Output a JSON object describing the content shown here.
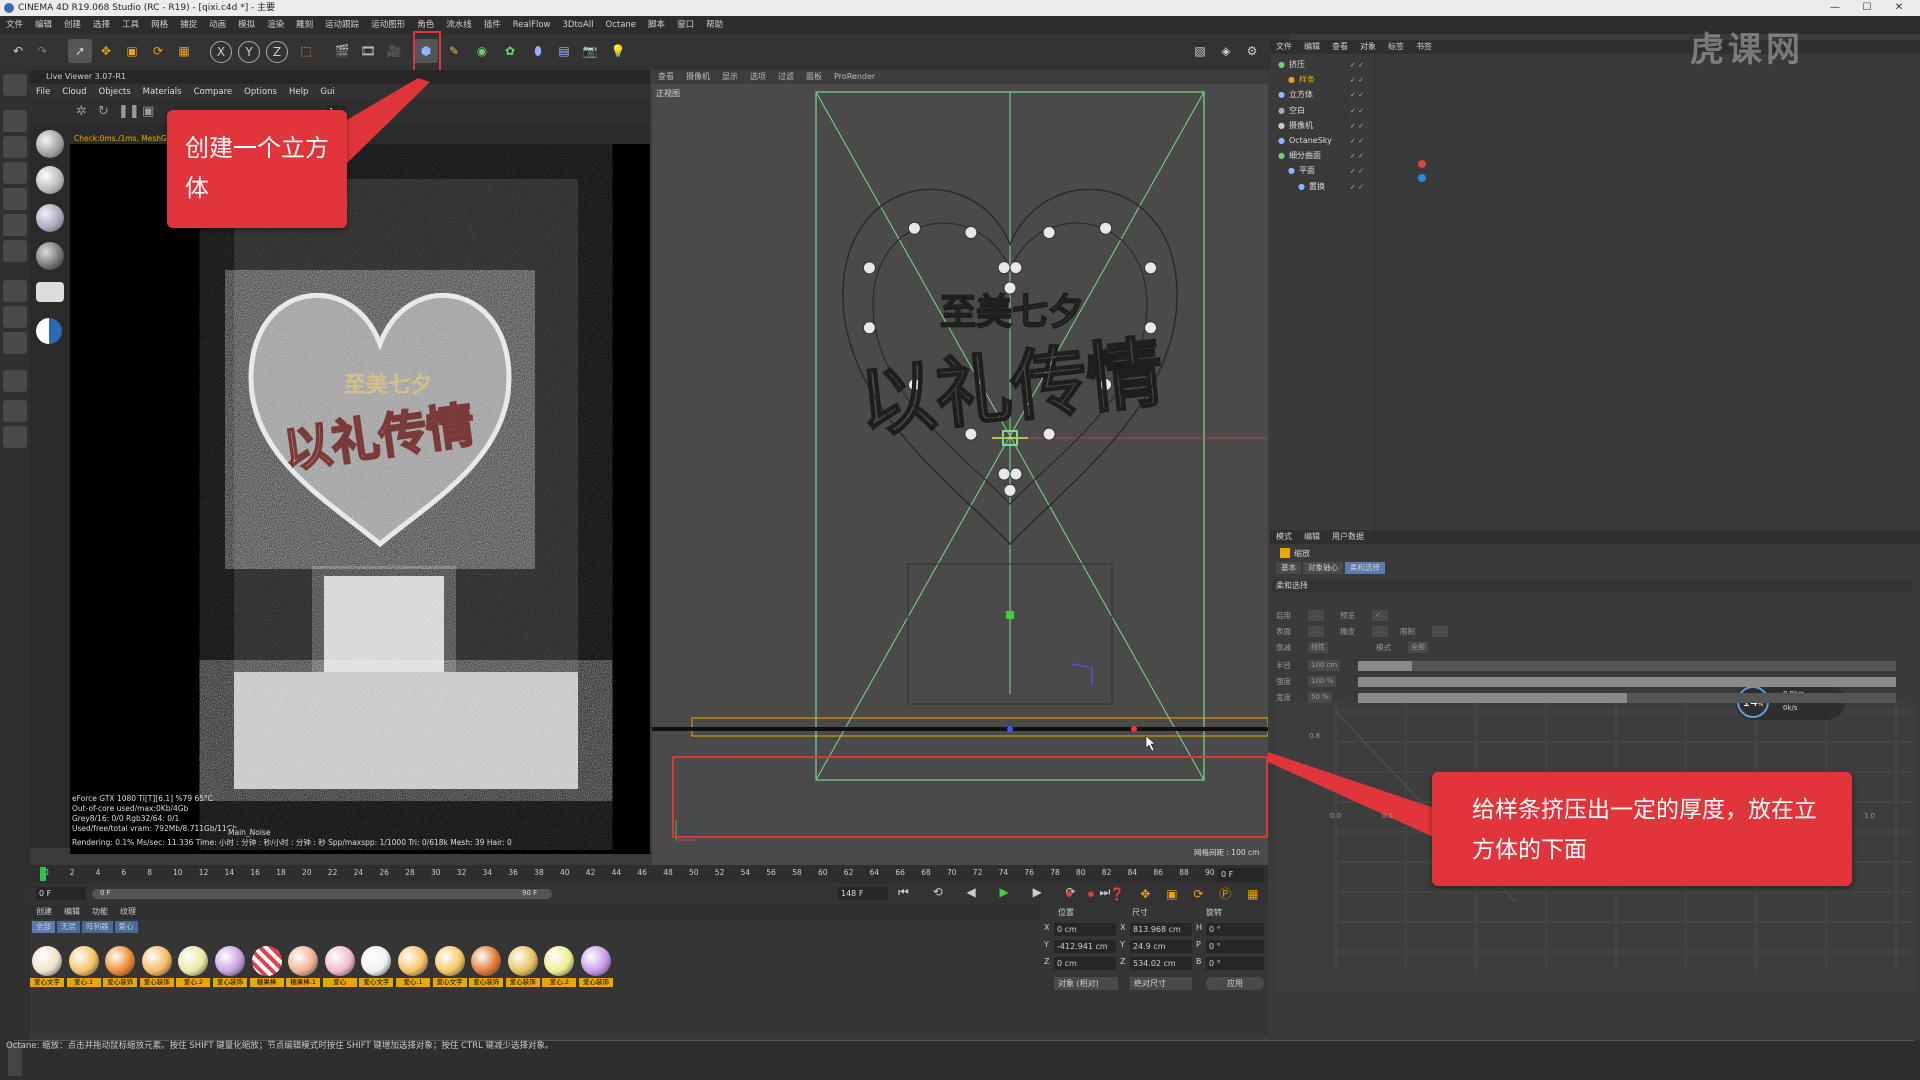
{
  "window": {
    "title": "CINEMA 4D R19.068 Studio (RC - R19) - [qixi.c4d *] - 主要"
  },
  "menubar": [
    "文件",
    "编辑",
    "创建",
    "选择",
    "工具",
    "网格",
    "捕捉",
    "动画",
    "模拟",
    "渲染",
    "雕刻",
    "运动跟踪",
    "运动图形",
    "角色",
    "流水线",
    "插件",
    "RealFlow",
    "3DtoAll",
    "Octane",
    "脚本",
    "窗口",
    "帮助"
  ],
  "toolbar": {
    "x": "X",
    "y": "Y",
    "z": "Z"
  },
  "liveviewer": {
    "title": "Live Viewer 3.07-R1",
    "menu": [
      "File",
      "Cloud",
      "Objects",
      "Materials",
      "Compare",
      "Options",
      "Help",
      "Gui"
    ],
    "check": "Check:0ms./1ms. MeshGen:0ms. Update[C]:0ms. Nodes:0 Movable:39 0 0",
    "stats": [
      "eForce GTX 1080 Ti[T][6.1] %79       65°C",
      "Out-of-core used/max:0Kb/4Gb",
      "Grey8/16: 0/0            Rgb32/64: 0/1",
      "Used/free/total vram: 792Mb/8.711Gb/11Gb"
    ],
    "main_noise": "Main_Noise",
    "rendering": "Rendering: 0.1%    Ms/sec: 11.336   Time: 小时 : 分钟 : 秒/小时 : 分钟 : 秒   Spp/maxspp: 1/1000   Tri: 0/618k   Mesh: 39   Hair: 0",
    "frame_value": "1"
  },
  "artwork": {
    "top": "至美七夕",
    "main": "以礼传情"
  },
  "viewport": {
    "menu": [
      "查看",
      "摄像机",
      "显示",
      "选项",
      "过滤",
      "面板",
      "ProRender"
    ],
    "label": "正视图",
    "grid": "网格间距 : 100 cm"
  },
  "timeline": {
    "ticks": [
      "0",
      "2",
      "4",
      "6",
      "8",
      "10",
      "12",
      "14",
      "16",
      "18",
      "20",
      "22",
      "24",
      "26",
      "28",
      "30",
      "32",
      "34",
      "36",
      "38",
      "40",
      "42",
      "44",
      "46",
      "48",
      "50",
      "52",
      "54",
      "56",
      "58",
      "60",
      "62",
      "64",
      "66",
      "68",
      "70",
      "72",
      "74",
      "76",
      "78",
      "80",
      "82",
      "84",
      "86",
      "88",
      "90"
    ],
    "frame_right": "0 F",
    "start": "0 F",
    "range_start": "0 F",
    "range_end": "90 F",
    "end": "148 F"
  },
  "materials": {
    "menu": [
      "创建",
      "编辑",
      "功能",
      "纹理"
    ],
    "tabs": [
      "全部",
      "无层",
      "阵列器",
      "爱心"
    ],
    "items": [
      {
        "label": "爱心文字",
        "color": "#f0e2c8"
      },
      {
        "label": "爱心.1",
        "color": "#f5c060"
      },
      {
        "label": "爱心装饰",
        "color": "#f08a30"
      },
      {
        "label": "爱心装饰",
        "color": "#f5b860"
      },
      {
        "label": "爱心.2",
        "color": "#e8e8a0"
      },
      {
        "label": "爱心装饰",
        "color": "#c8a0e0"
      },
      {
        "label": "糖果棒",
        "color": "#e04050"
      },
      {
        "label": "糖果棒.1",
        "color": "#f0b090"
      },
      {
        "label": "爱心",
        "color": "#f2b8c8"
      },
      {
        "label": "爱心文字",
        "color": "#f0f0f0"
      },
      {
        "label": "爱心.1",
        "color": "#f5c060"
      },
      {
        "label": "爱心文字",
        "color": "#f5c860"
      },
      {
        "label": "爱心装饰",
        "color": "#e07830"
      },
      {
        "label": "爱心装饰",
        "color": "#e8c060"
      },
      {
        "label": "爱心.2",
        "color": "#eeee90"
      },
      {
        "label": "爱心装饰",
        "color": "#c898e8"
      }
    ]
  },
  "coordinates": {
    "headers": [
      "位置",
      "尺寸",
      "旋转"
    ],
    "rows": [
      {
        "axis": "X",
        "pos": "0 cm",
        "size_axis": "X",
        "size": "813.968 cm",
        "rot_axis": "H",
        "rot": "0 °"
      },
      {
        "axis": "Y",
        "pos": "-412.941 cm",
        "size_axis": "Y",
        "size": "24.9 cm",
        "rot_axis": "P",
        "rot": "0 °"
      },
      {
        "axis": "Z",
        "pos": "0 cm",
        "size_axis": "Z",
        "size": "534.02 cm",
        "rot_axis": "B",
        "rot": "0 °"
      }
    ],
    "mode": "对象 (相对)",
    "size_mode": "绝对尺寸",
    "apply": "应用"
  },
  "object_manager": {
    "menu": [
      "文件",
      "编辑",
      "查看",
      "对象",
      "标签",
      "书签"
    ],
    "objects": [
      "挤压",
      "样条",
      "立方体",
      "空白",
      "摄像机",
      "OctaneSky",
      "细分曲面",
      "平面",
      "置换"
    ]
  },
  "attributes": {
    "menu": [
      "模式",
      "编辑",
      "用户数据"
    ],
    "title": "缩放",
    "tabs": [
      "基本",
      "对象轴心",
      "柔和选择"
    ],
    "section": "柔和选择",
    "fields": [
      {
        "label": "启用",
        "value": ""
      },
      {
        "label": "预览",
        "value": "✓"
      },
      {
        "label": "表面",
        "value": ""
      },
      {
        "label": "橡皮",
        "value": ""
      },
      {
        "label": "限制",
        "value": ""
      },
      {
        "label": "衰减",
        "value": "线性"
      },
      {
        "label": "模式",
        "value": "全部"
      },
      {
        "label": "半径",
        "value": "100 cm"
      },
      {
        "label": "强度",
        "value": "100 %"
      },
      {
        "label": "宽度",
        "value": "50 %"
      }
    ],
    "curve_ticks": [
      "0.8",
      "0.0",
      "0.1",
      "1.0"
    ],
    "speed": "14",
    "speed_unit": "%",
    "net_up": "0.9k/s",
    "net_down": "0k/s"
  },
  "status": "Octane:    缩放：点击并拖动鼠标缩放元素。按住 SHIFT 键量化缩放；节点编辑模式时按住 SHIFT 键增加选择对象；按住 CTRL 键减少选择对象。",
  "watermark": "虎课网",
  "callouts": {
    "top": "创建一个立方体",
    "bottom": "给样条挤压出一定的厚度，放在立方体的下面"
  },
  "colors": {
    "accent_red": "#e0353a",
    "orange": "#e8a800",
    "green_guide": "#7ed98a"
  }
}
